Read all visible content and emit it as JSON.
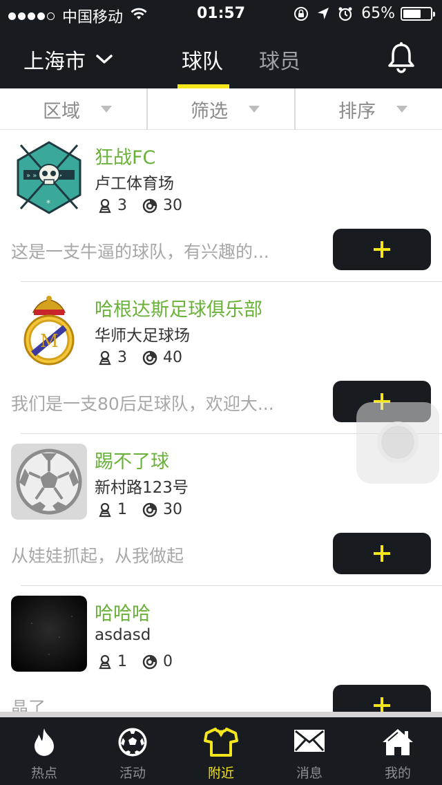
{
  "status_bar": {
    "signal_dots": 4,
    "carrier": "中国移动",
    "time": "01:57",
    "battery": "65%",
    "battery_level": 0.65,
    "icons": [
      "wifi-icon",
      "rotation-lock-icon",
      "location-icon",
      "alarm-icon",
      "battery-icon"
    ]
  },
  "nav": {
    "city": "上海市",
    "tabs": [
      {
        "label": "球队",
        "active": true
      },
      {
        "label": "球员",
        "active": false
      }
    ],
    "right_icon": "bell-icon"
  },
  "filters": [
    {
      "label": "区域"
    },
    {
      "label": "筛选"
    },
    {
      "label": "排序"
    }
  ],
  "teams": [
    {
      "name": "狂战FC",
      "venue": "卢工体育场",
      "members": "3",
      "score": "30",
      "desc": "这是一支牛逼的球队，有兴趣的...",
      "logo": "skull-emblem",
      "join_label": "+"
    },
    {
      "name": "哈根达斯足球俱乐部",
      "venue": "华师大足球场",
      "members": "3",
      "score": "40",
      "desc": "我们是一支80后足球队，欢迎大...",
      "logo": "real-madrid-crest",
      "join_label": "+"
    },
    {
      "name": "踢不了球",
      "venue": "新村路123号",
      "members": "1",
      "score": "30",
      "desc": "从娃娃抓起，从我做起",
      "logo": "soccer-ball-placeholder",
      "join_label": "+"
    },
    {
      "name": "哈哈哈",
      "venue": "asdasd",
      "members": "1",
      "score": "0",
      "desc": "晶了",
      "logo": "dark-photo",
      "join_label": "+"
    }
  ],
  "tabbar": [
    {
      "label": "热点",
      "icon": "flame-icon",
      "active": false
    },
    {
      "label": "活动",
      "icon": "soccer-ball-icon",
      "active": false
    },
    {
      "label": "附近",
      "icon": "jersey-icon",
      "active": true
    },
    {
      "label": "消息",
      "icon": "envelope-icon",
      "active": false
    },
    {
      "label": "我的",
      "icon": "home-icon",
      "active": false
    }
  ],
  "colors": {
    "dark": "#181b20",
    "accent_yellow": "#f5e51b",
    "team_name_green": "#6ab13a",
    "muted_text": "#a7a7a7"
  }
}
